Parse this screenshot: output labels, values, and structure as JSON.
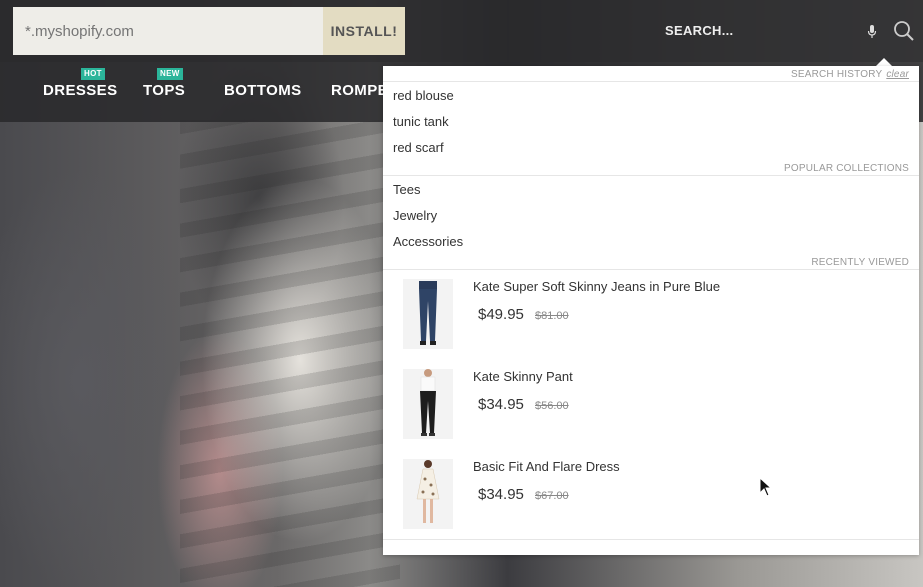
{
  "header": {
    "domain_placeholder": "*.myshopify.com",
    "install_label": "INSTALL!",
    "search_label": "SEARCH..."
  },
  "nav": {
    "items": [
      {
        "label": "DRESSES",
        "badge": "HOT"
      },
      {
        "label": "TOPS",
        "badge": "NEW"
      },
      {
        "label": "BOTTOMS",
        "badge": ""
      },
      {
        "label": "ROMPERS",
        "badge": ""
      }
    ]
  },
  "dropdown": {
    "search_history": {
      "title": "SEARCH HISTORY",
      "clear_label": "clear",
      "items": [
        "red blouse",
        "tunic tank",
        "red scarf"
      ]
    },
    "popular_collections": {
      "title": "POPULAR COLLECTIONS",
      "items": [
        "Tees",
        "Jewelry",
        "Accessories"
      ]
    },
    "recently_viewed": {
      "title": "RECENTLY VIEWED",
      "products": [
        {
          "name": "Kate Super Soft Skinny Jeans in Pure Blue",
          "price": "$49.95",
          "old_price": "$81.00"
        },
        {
          "name": "Kate Skinny Pant",
          "price": "$34.95",
          "old_price": "$56.00"
        },
        {
          "name": "Basic Fit And Flare Dress",
          "price": "$34.95",
          "old_price": "$67.00"
        }
      ]
    }
  },
  "colors": {
    "badge": "#2bb59a",
    "install_bg": "#e3dcc2",
    "bar_bg": "#28282a"
  }
}
